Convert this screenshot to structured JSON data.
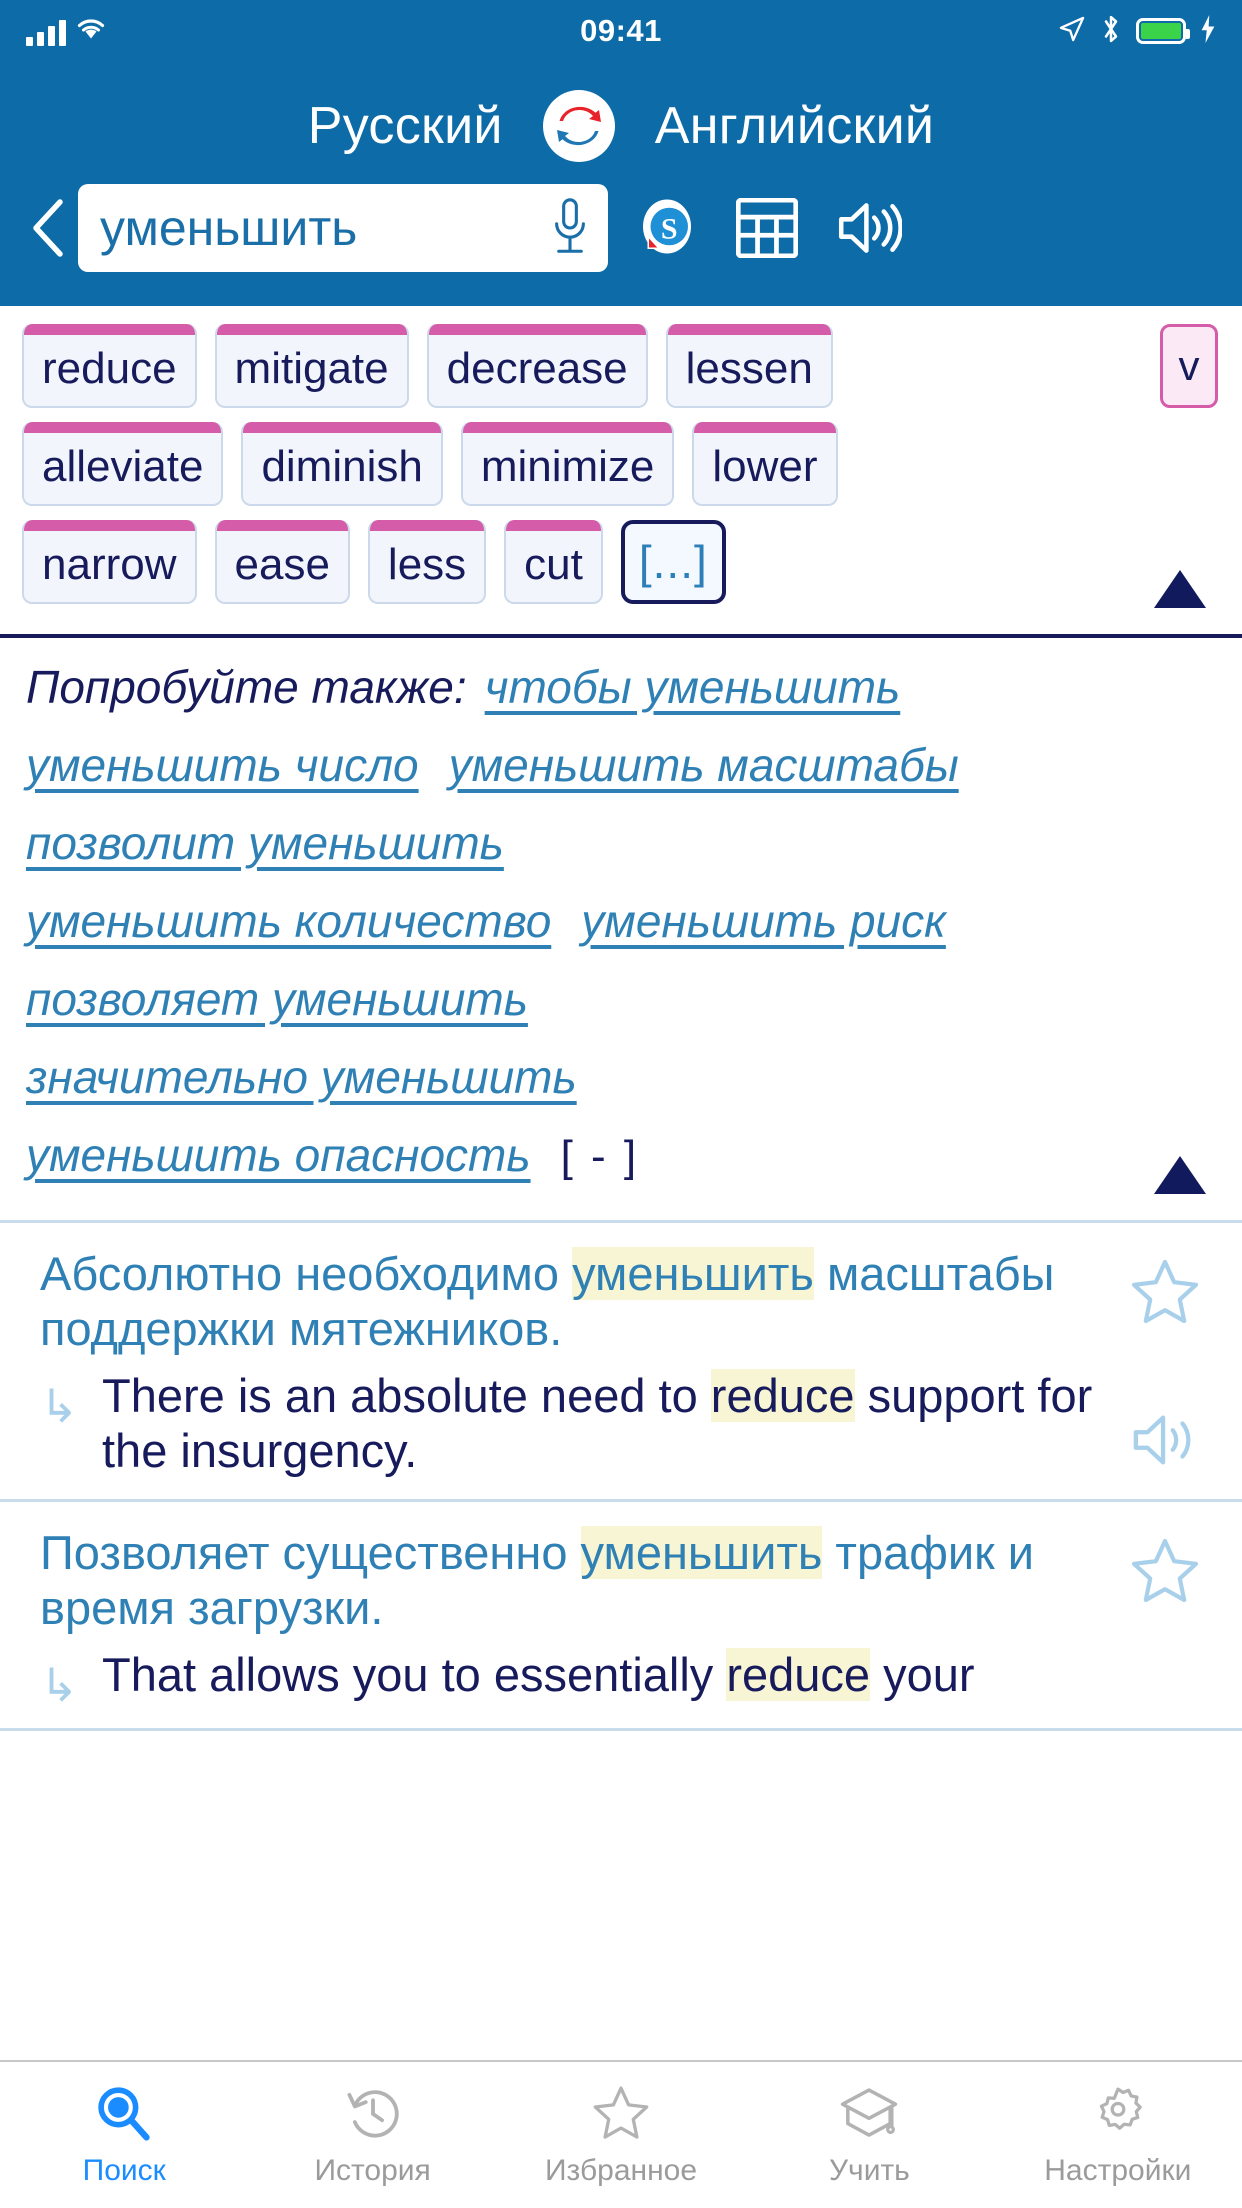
{
  "status_bar": {
    "time": "09:41",
    "icons": [
      "signal-bars-icon",
      "wifi-icon",
      "location-arrow-icon",
      "bluetooth-icon",
      "battery-icon",
      "charging-bolt-icon"
    ]
  },
  "header": {
    "source_language": "Русский",
    "target_language": "Английский",
    "swap_icon": "swap-languages-icon",
    "background_color": "#0d6ba8"
  },
  "search": {
    "back_label": "‹",
    "query": "уменьшить",
    "placeholder": "уменьшить",
    "mic_icon": "microphone-icon",
    "conjugation_icon": "conjugation-s-icon",
    "table_icon": "grid-table-icon",
    "speak_icon": "speaker-icon"
  },
  "translations": {
    "rows": [
      [
        "reduce",
        "mitigate",
        "decrease",
        "lessen"
      ],
      [
        "alleviate",
        "diminish",
        "minimize",
        "lower"
      ],
      [
        "narrow",
        "ease",
        "less",
        "cut"
      ]
    ],
    "more_chip": "[...]",
    "pos_badge": "v",
    "collapse_icon": "collapse-up-arrow-icon",
    "chip_accent_color": "#d45ca8",
    "chip_text_color": "#171b5c"
  },
  "suggestions": {
    "label": "Попробуйте также:",
    "lines": [
      [
        "чтобы уменьшить"
      ],
      [
        "уменьшить число",
        "уменьшить масштабы"
      ],
      [
        "позволит уменьшить"
      ],
      [
        "уменьшить количество",
        "уменьшить риск"
      ],
      [
        "позволяет уменьшить"
      ],
      [
        "значительно уменьшить"
      ],
      [
        "уменьшить опасность"
      ]
    ],
    "minus_marker": "[ - ]",
    "collapse_icon": "collapse-up-arrow-icon",
    "link_color": "#2f80b4"
  },
  "examples": [
    {
      "source_pre": "Абсолютно необходимо ",
      "source_hl": "уменьшить",
      "source_post": " масштабы поддержки мятежников.",
      "arrow": "↳",
      "target_pre": "There is an absolute need to ",
      "target_hl": "reduce",
      "target_post": " support for the insurgency.",
      "favorite_icon": "star-outline-icon",
      "speak_icon": "speaker-icon"
    },
    {
      "source_pre": "Позволяет существенно ",
      "source_hl": "уменьшить",
      "source_post": " трафик и время загрузки.",
      "arrow": "↳",
      "target_pre": "That allows you to essentially ",
      "target_hl": "reduce",
      "target_post": " your",
      "favorite_icon": "star-outline-icon",
      "speak_icon": "speaker-icon"
    }
  ],
  "tabbar": {
    "items": [
      {
        "label": "Поиск",
        "icon": "search-icon",
        "active": true
      },
      {
        "label": "История",
        "icon": "history-clock-icon",
        "active": false
      },
      {
        "label": "Избранное",
        "icon": "star-outline-icon",
        "active": false
      },
      {
        "label": "Учить",
        "icon": "graduation-cap-icon",
        "active": false
      },
      {
        "label": "Настройки",
        "icon": "gear-icon",
        "active": false
      }
    ],
    "active_color": "#1a8cff",
    "inactive_color": "#9b9b9b"
  }
}
